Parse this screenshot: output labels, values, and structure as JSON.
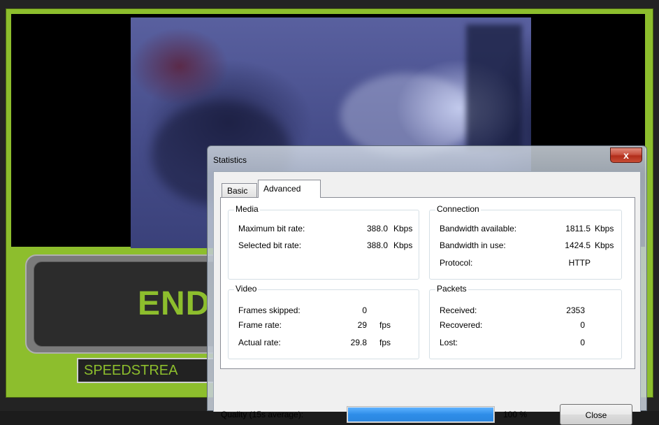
{
  "background": {
    "banner_text": "END",
    "subbanner_text": "SPEEDSTREA",
    "accent_color": "#8dbe2d"
  },
  "dialog": {
    "title": "Statistics",
    "close_glyph": "x",
    "tabs": [
      {
        "label": "Basic",
        "selected": false
      },
      {
        "label": "Advanced",
        "selected": true
      }
    ],
    "media": {
      "title": "Media",
      "rows": [
        {
          "label": "Maximum bit rate:",
          "value": "388.0",
          "unit": "Kbps"
        },
        {
          "label": "Selected bit rate:",
          "value": "388.0",
          "unit": "Kbps"
        }
      ]
    },
    "connection": {
      "title": "Connection",
      "rows": [
        {
          "label": "Bandwidth available:",
          "value": "1811.5",
          "unit": "Kbps"
        },
        {
          "label": "Bandwidth in use:",
          "value": "1424.5",
          "unit": "Kbps"
        },
        {
          "label": "Protocol:",
          "value": "HTTP",
          "unit": ""
        }
      ]
    },
    "video": {
      "title": "Video",
      "rows": [
        {
          "label": "Frames skipped:",
          "value": "0",
          "unit": ""
        },
        {
          "label": "Frame rate:",
          "value": "29",
          "unit": "fps"
        },
        {
          "label": "Actual rate:",
          "value": "29.8",
          "unit": "fps"
        }
      ]
    },
    "packets": {
      "title": "Packets",
      "rows": [
        {
          "label": "Received:",
          "value": "2353",
          "unit": ""
        },
        {
          "label": "Recovered:",
          "value": "0",
          "unit": ""
        },
        {
          "label": "Lost:",
          "value": "0",
          "unit": ""
        }
      ]
    },
    "quality": {
      "label": "Quality (15s average):",
      "percent_text": "100 %",
      "fraction": 1.0
    },
    "close_label": "Close"
  }
}
